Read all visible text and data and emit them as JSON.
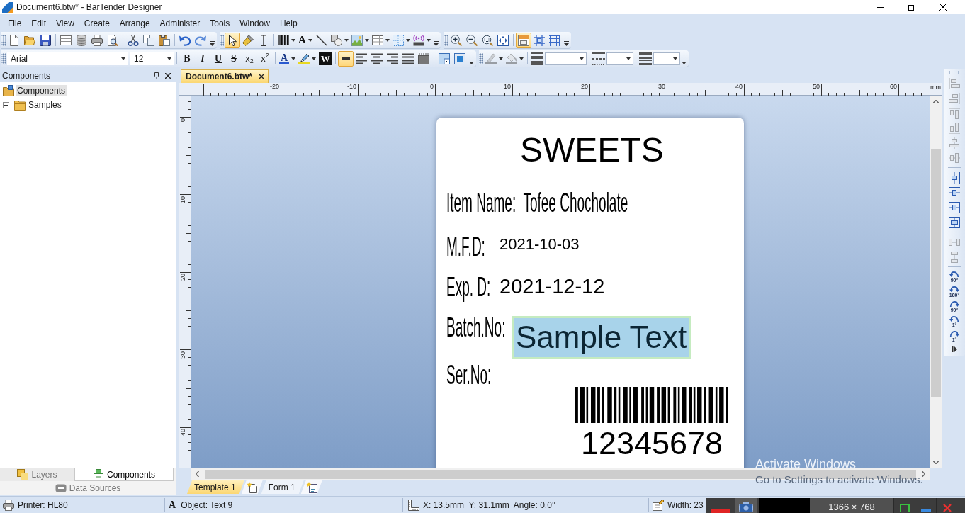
{
  "window": {
    "title": "Document6.btw* - BarTender Designer"
  },
  "menu": [
    "File",
    "Edit",
    "View",
    "Create",
    "Arrange",
    "Administer",
    "Tools",
    "Window",
    "Help"
  ],
  "tools_toolbar": {
    "tools": [
      {
        "selected": true
      },
      {
        "selected": false
      },
      {
        "selected": false
      },
      {
        "selected": false
      },
      {
        "label": "A",
        "selected": false
      },
      {
        "selected": false
      },
      {
        "selected": false
      },
      {
        "selected": false
      },
      {
        "selected": false
      },
      {
        "selected": false
      },
      {
        "selected": false
      }
    ]
  },
  "view_toolbar": {
    "toggles": [
      {
        "selected": true
      },
      {
        "selected": false
      },
      {
        "selected": false
      }
    ]
  },
  "format_toolbar": {
    "font": "Arial",
    "size": "12",
    "styles": [
      {
        "label": "B",
        "selected": false
      },
      {
        "label": "I",
        "selected": false
      },
      {
        "label": "U",
        "selected": false
      },
      {
        "label": "S",
        "selected": false
      },
      {
        "label": "x$_{2}$",
        "selected": false
      },
      {
        "label": "x$^{2}$",
        "selected": false
      }
    ],
    "color_buttons": [
      "A",
      "W"
    ],
    "alignment": [
      {
        "selected": true
      },
      {
        "selected": false
      },
      {
        "selected": false
      },
      {
        "selected": false
      },
      {
        "selected": false
      },
      {
        "selected": false
      }
    ]
  },
  "line_toolbar": {
    "tools": [
      {
        "disabled": true
      },
      {
        "disabled": true
      }
    ]
  },
  "components_panel": {
    "title": "Components",
    "tree": [
      {
        "label": "Components",
        "selected": true
      },
      {
        "label": "Samples",
        "selected": false,
        "expanded": false
      }
    ],
    "tabs": [
      {
        "label": "Layers",
        "selected": false
      },
      {
        "label": "Components",
        "selected": true
      },
      {
        "label": "Data Sources",
        "selected": false
      }
    ]
  },
  "document_tabs": [
    {
      "label": "Document6.btw*",
      "selected": true
    }
  ],
  "ruler": {
    "horizontal": [
      "-20",
      "-10",
      "0",
      "10",
      "20",
      "30",
      "40",
      "50",
      "60"
    ],
    "unit": "mm",
    "vertical": [
      "0",
      "10",
      "20",
      "30",
      "40"
    ]
  },
  "label": {
    "objects": [
      {
        "kind": "text",
        "text": "SWEETS",
        "selected": false
      },
      {
        "kind": "narrow",
        "text": "Item Name:  Tofee Chocholate",
        "selected": false
      },
      {
        "kind": "narrow",
        "text": "M.F.D:",
        "selected": false
      },
      {
        "kind": "text",
        "text": "2021-10-03",
        "selected": false
      },
      {
        "kind": "narrow",
        "text": "Exp. D:",
        "selected": false
      },
      {
        "kind": "text",
        "text": "2021-12-12",
        "selected": false
      },
      {
        "kind": "narrow",
        "text": "Batch.No:",
        "selected": false
      },
      {
        "kind": "text",
        "text": "Sample Text",
        "selected": true
      },
      {
        "kind": "narrow",
        "text": "Ser.No:",
        "selected": false
      },
      {
        "kind": "barcode",
        "text": "12345678",
        "selected": false
      }
    ]
  },
  "page_tabs": [
    {
      "label": "Template 1",
      "selected": true
    },
    {
      "label": "Form 1",
      "selected": false
    }
  ],
  "align_toolbar": {
    "buttons": [
      {
        "disabled": true
      },
      {
        "disabled": true
      },
      {
        "disabled": true
      },
      {
        "disabled": true
      },
      {
        "disabled": true
      },
      {
        "disabled": true
      },
      {
        "disabled": false
      },
      {
        "disabled": false
      },
      {
        "disabled": false
      },
      {
        "disabled": false
      },
      {
        "disabled": true
      },
      {
        "disabled": true
      },
      {
        "label": "90°",
        "disabled": false
      },
      {
        "label": "180°",
        "disabled": false
      },
      {
        "label": "90°",
        "disabled": false
      },
      {
        "label": "1°",
        "disabled": false
      },
      {
        "label": "1°",
        "disabled": false
      }
    ]
  },
  "status_bar": [
    {
      "text": "Printer: HL80"
    },
    {
      "glyph": "A",
      "text": "Object: Text 9"
    },
    {
      "text": "X: 13.5mm  Y: 31.1mm  Angle: 0.0°"
    },
    {
      "text": "Width: 23"
    }
  ],
  "activation_notice": [
    "Activate Windows",
    "Go to Settings to activate Windows."
  ],
  "capture_toolbar": {
    "size": "1366 × 768"
  }
}
